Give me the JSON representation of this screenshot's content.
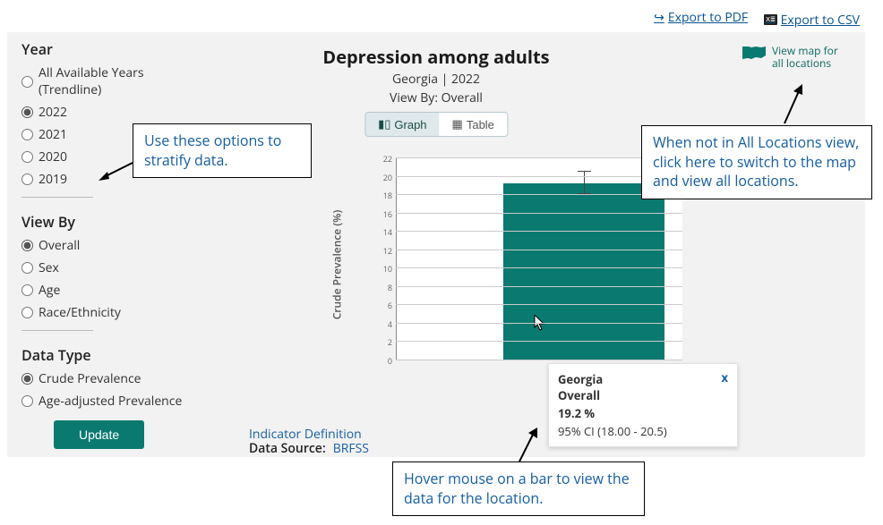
{
  "export": {
    "pdf": "Export to PDF",
    "csv": "Export to CSV"
  },
  "sidebar": {
    "year_title": "Year",
    "years": [
      {
        "label": "All Available Years (Trendline)",
        "checked": false
      },
      {
        "label": "2022",
        "checked": true
      },
      {
        "label": "2021",
        "checked": false
      },
      {
        "label": "2020",
        "checked": false
      },
      {
        "label": "2019",
        "checked": false
      }
    ],
    "viewby_title": "View By",
    "viewby": [
      {
        "label": "Overall",
        "checked": true
      },
      {
        "label": "Sex",
        "checked": false
      },
      {
        "label": "Age",
        "checked": false
      },
      {
        "label": "Race/Ethnicity",
        "checked": false
      }
    ],
    "datatype_title": "Data Type",
    "datatype": [
      {
        "label": "Crude Prevalence",
        "checked": true
      },
      {
        "label": "Age-adjusted Prevalence",
        "checked": false
      }
    ],
    "update_btn": "Update"
  },
  "header": {
    "title": "Depression among adults",
    "subtitle1": "Georgia | 2022",
    "subtitle2": "View By: Overall",
    "graph_tab": "Graph",
    "table_tab": "Table"
  },
  "map_link": {
    "line1": "View map for",
    "line2": "all locations"
  },
  "chart_data": {
    "type": "bar",
    "categories": [
      "Georgia"
    ],
    "series_label": "Overall",
    "values": [
      19.2
    ],
    "ci_low": [
      18.0
    ],
    "ci_high": [
      20.5
    ],
    "unit": "%",
    "ylabel": "Crude Prevalence (%)",
    "ylim": [
      0,
      22
    ],
    "yticks": [
      0,
      2,
      4,
      6,
      8,
      10,
      12,
      14,
      16,
      18,
      20,
      22
    ]
  },
  "tooltip": {
    "location": "Georgia",
    "stratum": "Overall",
    "value": "19.2 %",
    "ci": "95% CI (18.00 - 20.5)"
  },
  "meta": {
    "indicator_def": "Indicator Definition",
    "data_source_label": "Data Source:",
    "data_source": "BRFSS"
  },
  "callouts": {
    "stratify": "Use these options to stratify data.",
    "maplink": "When not in All Locations view, click here to switch to the map and view all locations.",
    "hover": "Hover mouse on a bar to view the data for the location."
  }
}
